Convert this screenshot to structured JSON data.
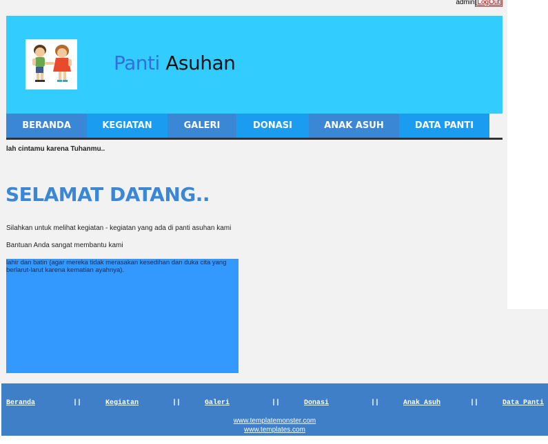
{
  "admin": {
    "user": "admin",
    "logout_label": "LogOut",
    "open_bracket": "[",
    "close_bracket": "]"
  },
  "header": {
    "title_part1": "Panti",
    "title_part2": "Asuhan",
    "bg_color": "#33ccff"
  },
  "nav": {
    "items": [
      {
        "label": "BERANDA",
        "color": "#3a87d6"
      },
      {
        "label": "KEGIATAN",
        "color": "#1a9cf0"
      },
      {
        "label": "GALERI",
        "color": "#3a87d6"
      },
      {
        "label": "DONASI",
        "color": "#1a9cf0"
      },
      {
        "label": "ANAK ASUH",
        "color": "#3a87d6"
      },
      {
        "label": "DATA PANTI",
        "color": "#1a9cf0"
      }
    ]
  },
  "marquee_text": "lah cintamu karena Tuhanmu..",
  "main": {
    "welcome_title": "SELAMAT DATANG..",
    "paragraph1": "Silahkan untuk melihat kegiatan - kegiatan yang ada di panti asuhan kami",
    "paragraph2": "Bantuan Anda sangat membantu kami",
    "scroll_text": "lahir dan batin (agar mereka tidak merasakan kesedihan dan duka cita yang berlarut-larut karena kematian ayahnya)."
  },
  "footer": {
    "links": [
      "Beranda",
      "Kegiatan",
      "Galeri",
      "Donasi",
      "Anak Asuh",
      "Data Panti"
    ],
    "separator": "||",
    "credit1": "www.templatemonster.com",
    "credit2": "www.templates.com",
    "bg_color": "#3f7fc8"
  }
}
